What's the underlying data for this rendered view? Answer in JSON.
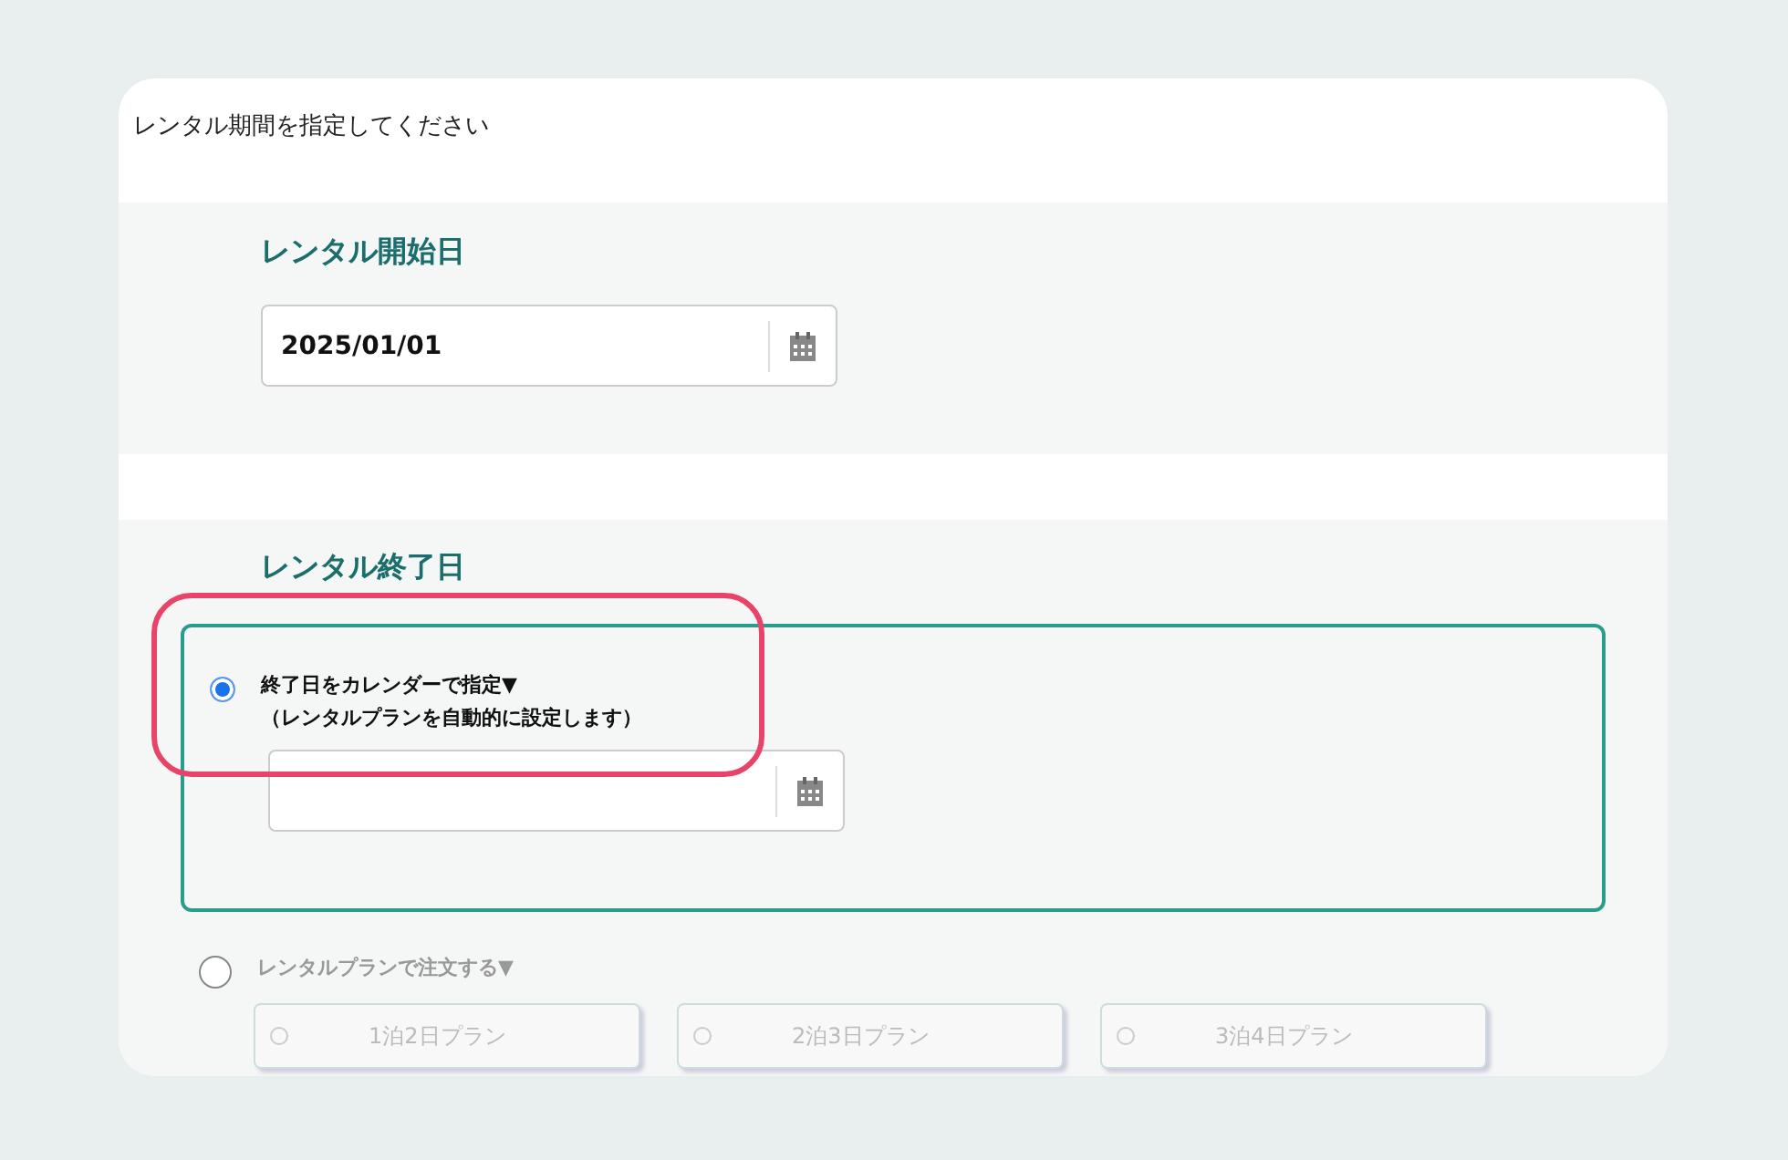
{
  "title": "レンタル期間を指定してください",
  "start": {
    "heading": "レンタル開始日",
    "value": "2025/01/01"
  },
  "end": {
    "heading": "レンタル終了日",
    "options": [
      {
        "kind": "calendar",
        "selected": true,
        "disabled": false,
        "label": "終了日をカレンダーで指定▼",
        "note": "（レンタルプランを自動的に設定します）"
      },
      {
        "kind": "plans",
        "selected": false,
        "disabled": true,
        "label": "レンタルプランで注文する▼",
        "plans": [
          {
            "label": "1泊2日プラン",
            "selected": false
          },
          {
            "label": "2泊3日プラン",
            "selected": false
          },
          {
            "label": "3泊4日プラン",
            "selected": false
          }
        ]
      }
    ]
  }
}
